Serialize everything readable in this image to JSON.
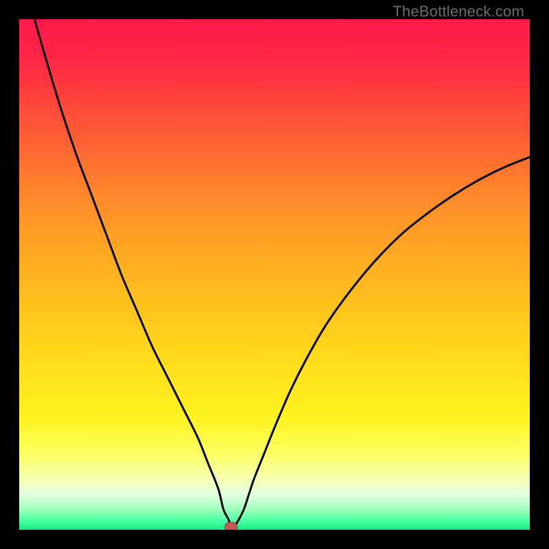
{
  "watermark": "TheBottleneck.com",
  "colors": {
    "frame": "#000000",
    "curve": "#000000",
    "marker_fill": "#c05a5a",
    "marker_stroke": "#a04040",
    "gradient": {
      "stops": [
        {
          "offset": 0.0,
          "color": "#ff1a4a"
        },
        {
          "offset": 0.08,
          "color": "#ff2745"
        },
        {
          "offset": 0.2,
          "color": "#ff5236"
        },
        {
          "offset": 0.35,
          "color": "#ff8a2a"
        },
        {
          "offset": 0.5,
          "color": "#ffb31f"
        },
        {
          "offset": 0.65,
          "color": "#ffd81a"
        },
        {
          "offset": 0.78,
          "color": "#fff21f"
        },
        {
          "offset": 0.85,
          "color": "#fcff60"
        },
        {
          "offset": 0.9,
          "color": "#f6ffb0"
        },
        {
          "offset": 0.93,
          "color": "#e3ffdf"
        },
        {
          "offset": 0.96,
          "color": "#9fffc0"
        },
        {
          "offset": 0.985,
          "color": "#3fff9e"
        },
        {
          "offset": 1.0,
          "color": "#17e880"
        }
      ]
    }
  },
  "chart_data": {
    "type": "line",
    "title": "",
    "xlabel": "",
    "ylabel": "",
    "xlim": [
      0,
      100
    ],
    "ylim": [
      0,
      100
    ],
    "x": [
      3,
      5,
      8,
      11,
      14,
      17,
      20,
      23,
      26,
      29,
      32,
      35,
      37,
      39,
      40,
      41,
      41.5,
      42,
      43,
      44,
      45,
      46,
      48,
      50,
      53,
      56,
      60,
      65,
      70,
      75,
      80,
      85,
      90,
      95,
      100
    ],
    "series": [
      {
        "name": "bottleneck-curve",
        "values": [
          100,
          93,
          83,
          74,
          66,
          58,
          50,
          43,
          36,
          30,
          24,
          18,
          13,
          8,
          4,
          2,
          0.5,
          0.5,
          2,
          4,
          7,
          10,
          15,
          20,
          27,
          33,
          40,
          47,
          53,
          58,
          62,
          65.5,
          68.5,
          71,
          73
        ]
      }
    ],
    "marker": {
      "x": 41.5,
      "y": 0.5
    }
  }
}
